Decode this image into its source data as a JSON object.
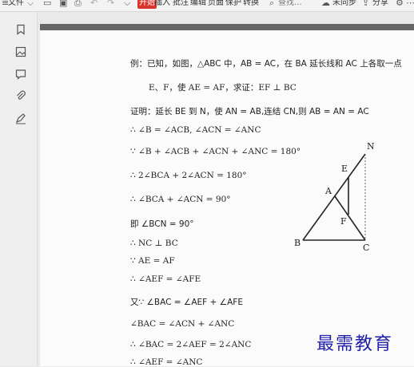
{
  "toolbar": {
    "file_label": "文件",
    "open_badge": "开始",
    "menu_items": [
      "插入",
      "批注",
      "编辑",
      "页面",
      "保护",
      "转换"
    ],
    "search_label": "查找...",
    "sync_label": "未同步",
    "share_label": "分享"
  },
  "sidebar": {
    "icons": [
      "bookmark-icon",
      "thumbnail-icon",
      "comment-icon",
      "attachment-icon",
      "signature-icon"
    ]
  },
  "document": {
    "lines": [
      "例：已知，如图，△ABC 中，AB = AC，在 BA 延长线和 AC 上各取一点",
      "E、F，使 AE = AF，求证：EF ⊥ BC",
      "证明：延长 BE 到 N，使 AN = AB,连结 CN,则 AB = AN = AC",
      "∴ ∠B = ∠ACB, ∠ACN = ∠ANC",
      "∵ ∠B + ∠ACB + ∠ACN + ∠ANC = 180°",
      "∴ 2∠BCA + 2∠ACN = 180°",
      "∴ ∠BCA + ∠ACN = 90°",
      "即 ∠BCN = 90°",
      "∴ NC ⊥ BC",
      "∵ AE = AF",
      "∴ ∠AEF = ∠AFE",
      "又∵ ∠BAC = ∠AEF  + ∠AFE",
      "∠BAC = ∠ACN  + ∠ANC",
      "∴ ∠BAC = 2∠AEF = 2∠ANC",
      "∴ ∠AEF = ∠ANC"
    ],
    "figure_labels": {
      "N": "N",
      "E": "E",
      "A": "A",
      "F": "F",
      "B": "B",
      "C": "C"
    }
  },
  "watermark": "最需教育"
}
